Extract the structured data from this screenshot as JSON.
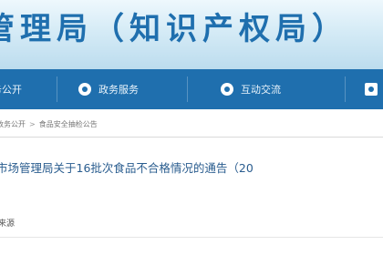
{
  "header": {
    "title": "管理局（知识产权局）"
  },
  "nav": {
    "items": [
      {
        "label": "政务公开",
        "icon": "nav-bullet-icon"
      },
      {
        "label": "政务服务",
        "icon": "nav-bullet-icon"
      },
      {
        "label": "互动交流",
        "icon": "nav-bullet-icon"
      }
    ]
  },
  "breadcrumb": {
    "items": [
      "政务公开",
      "食品安全抽检公告"
    ]
  },
  "article": {
    "title": "市场管理局关于16批次食品不合格情况的通告（20",
    "meta": "来源"
  },
  "colors": {
    "brand_blue": "#1f6fae",
    "banner_light": "#d5ebf6"
  }
}
